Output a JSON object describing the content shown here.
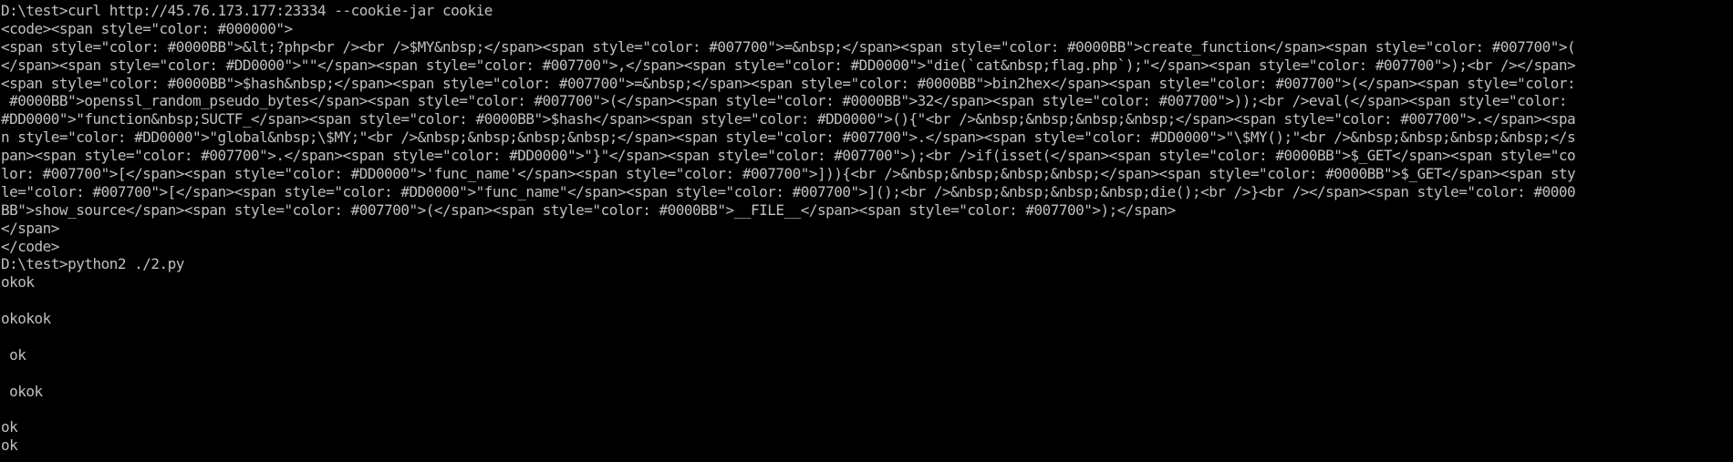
{
  "console": {
    "lines": [
      "D:\\test>curl http://45.76.173.177:23334 --cookie-jar cookie",
      "<code><span style=\"color: #000000\">",
      "<span style=\"color: #0000BB\">&lt;?php<br /><br />$MY&nbsp;</span><span style=\"color: #007700\">=&nbsp;</span><span style=\"color: #0000BB\">create_function</span><span style=\"color: #007700\">(",
      "</span><span style=\"color: #DD0000\">\"\"</span><span style=\"color: #007700\">,</span><span style=\"color: #DD0000\">\"die(`cat&nbsp;flag.php`);\"</span><span style=\"color: #007700\">);<br /></span>",
      "<span style=\"color: #0000BB\">$hash&nbsp;</span><span style=\"color: #007700\">=&nbsp;</span><span style=\"color: #0000BB\">bin2hex</span><span style=\"color: #007700\">(</span><span style=\"color:",
      " #0000BB\">openssl_random_pseudo_bytes</span><span style=\"color: #007700\">(</span><span style=\"color: #0000BB\">32</span><span style=\"color: #007700\">));<br />eval(</span><span style=\"color:",
      "#DD0000\">\"function&nbsp;SUCTF_</span><span style=\"color: #0000BB\">$hash</span><span style=\"color: #DD0000\">(){\"<br />&nbsp;&nbsp;&nbsp;&nbsp;</span><span style=\"color: #007700\">.</span><spa",
      "n style=\"color: #DD0000\">\"global&nbsp;\\$MY;\"<br />&nbsp;&nbsp;&nbsp;&nbsp;</span><span style=\"color: #007700\">.</span><span style=\"color: #DD0000\">\"\\$MY();\"<br />&nbsp;&nbsp;&nbsp;&nbsp;</s",
      "pan><span style=\"color: #007700\">.</span><span style=\"color: #DD0000\">\"}\"</span><span style=\"color: #007700\">);<br />if(isset(</span><span style=\"color: #0000BB\">$_GET</span><span style=\"co",
      "lor: #007700\">[</span><span style=\"color: #DD0000\">'func_name'</span><span style=\"color: #007700\">])){<br />&nbsp;&nbsp;&nbsp;&nbsp;</span><span style=\"color: #0000BB\">$_GET</span><span sty",
      "le=\"color: #007700\">[</span><span style=\"color: #DD0000\">\"func_name\"</span><span style=\"color: #007700\">]();<br />&nbsp;&nbsp;&nbsp;&nbsp;die();<br />}<br /></span><span style=\"color: #0000",
      "BB\">show_source</span><span style=\"color: #007700\">(</span><span style=\"color: #0000BB\">__FILE__</span><span style=\"color: #007700\">);</span>",
      "</span>",
      "</code>",
      "D:\\test>python2 ./2.py",
      "okok",
      "",
      "okokok",
      "",
      " ok",
      "",
      " okok",
      "",
      "ok",
      "ok"
    ]
  }
}
